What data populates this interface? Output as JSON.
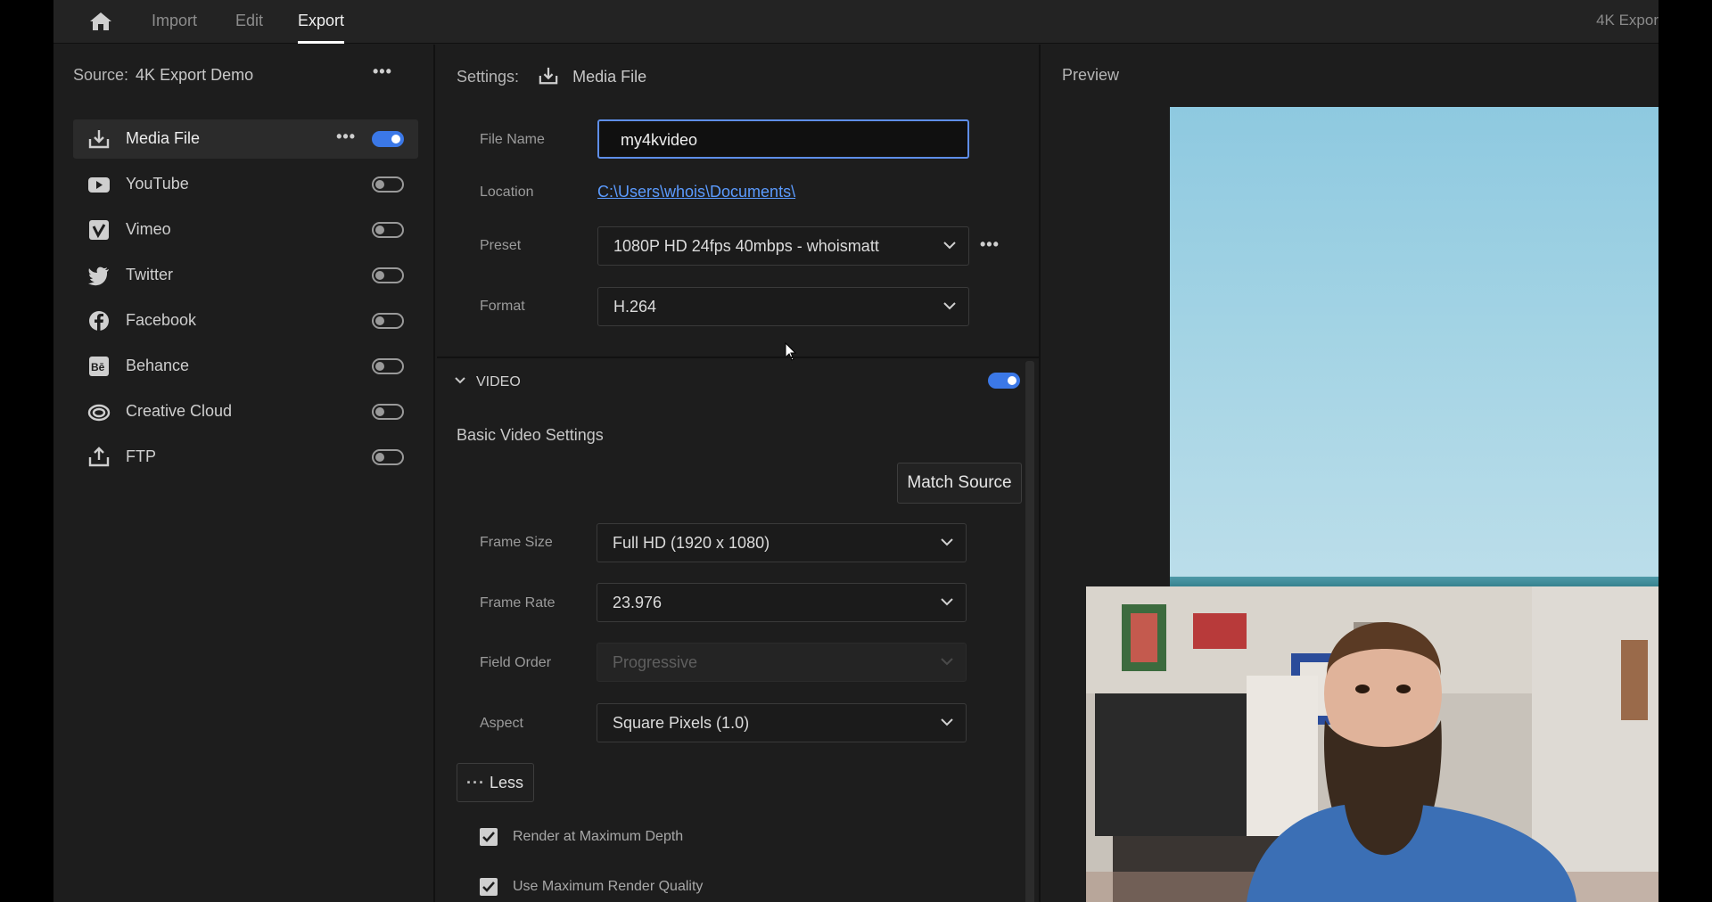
{
  "header": {
    "nav": [
      "Import",
      "Edit",
      "Export"
    ],
    "active_tab": "Export",
    "project_title": "4K Expor"
  },
  "source": {
    "label": "Source:",
    "name": "4K Export Demo"
  },
  "destinations": [
    {
      "label": "Media File",
      "icon": "media-file-icon",
      "enabled": true
    },
    {
      "label": "YouTube",
      "icon": "youtube-icon",
      "enabled": false
    },
    {
      "label": "Vimeo",
      "icon": "vimeo-icon",
      "enabled": false
    },
    {
      "label": "Twitter",
      "icon": "twitter-icon",
      "enabled": false
    },
    {
      "label": "Facebook",
      "icon": "facebook-icon",
      "enabled": false
    },
    {
      "label": "Behance",
      "icon": "behance-icon",
      "enabled": false
    },
    {
      "label": "Creative Cloud",
      "icon": "creative-cloud-icon",
      "enabled": false
    },
    {
      "label": "FTP",
      "icon": "ftp-icon",
      "enabled": false
    }
  ],
  "settings": {
    "label": "Settings:",
    "destination": "Media File",
    "file_name_label": "File Name",
    "file_name": "my4kvideo",
    "location_label": "Location",
    "location": "C:\\Users\\whois\\Documents\\",
    "preset_label": "Preset",
    "preset": "1080P HD 24fps 40mbps - whoismatt",
    "format_label": "Format",
    "format": "H.264"
  },
  "video": {
    "section_label": "VIDEO",
    "enabled": true,
    "basic_title": "Basic Video Settings",
    "match_source": "Match Source",
    "frame_size_label": "Frame Size",
    "frame_size": "Full HD (1920 x 1080)",
    "frame_rate_label": "Frame Rate",
    "frame_rate": "23.976",
    "field_order_label": "Field Order",
    "field_order": "Progressive",
    "aspect_label": "Aspect",
    "aspect": "Square Pixels (1.0)",
    "less_label": "Less",
    "render_max_depth": "Render at Maximum Depth",
    "render_max_depth_checked": true,
    "max_render_quality": "Use Maximum Render Quality",
    "max_render_quality_checked": true
  },
  "preview": {
    "title": "Preview"
  },
  "colors": {
    "accent": "#3b78e7",
    "link": "#5b9bff",
    "panel_bg": "#1d1d1d"
  }
}
